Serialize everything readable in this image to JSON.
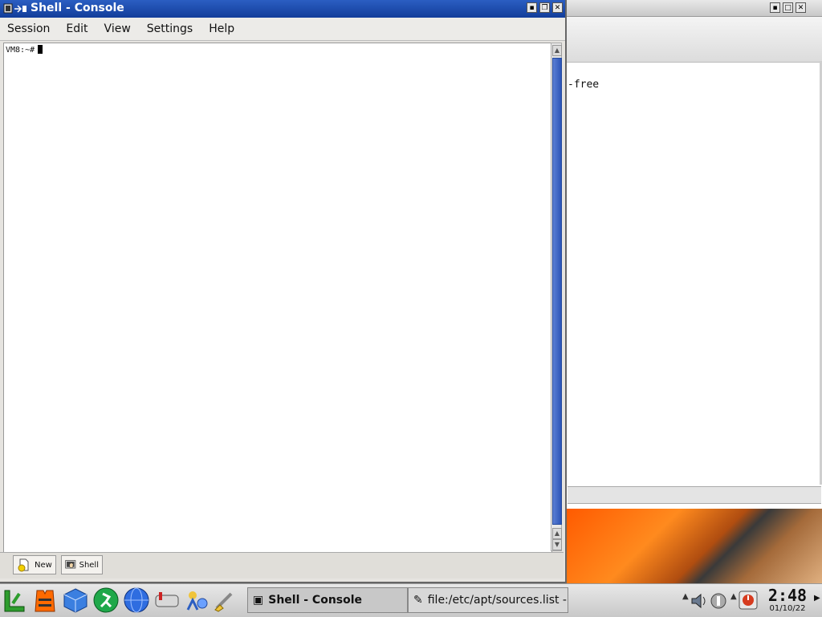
{
  "console": {
    "title": "Shell - Console",
    "menu": [
      "Session",
      "Edit",
      "View",
      "Settings",
      "Help"
    ],
    "prompt": "VM8:~#",
    "tabs": [
      {
        "label": "New",
        "icon": "new-session-icon"
      },
      {
        "label": "Shell",
        "icon": "shell-icon"
      }
    ]
  },
  "back_window": {
    "visible_text": "-free"
  },
  "taskbar": {
    "launchers": [
      "kde-menu-icon",
      "lifejacket-icon",
      "cube-icon",
      "runner-icon",
      "globe-icon",
      "mailbox-icon",
      "settings-icon",
      "brush-icon"
    ],
    "tasks": [
      {
        "label": "Shell - Console",
        "active": true
      },
      {
        "label": "file:/etc/apt/sources.list - T",
        "active": false
      }
    ],
    "clock": {
      "time": "2:48",
      "date": "01/10/22"
    }
  },
  "colors": {
    "title_active": "#1f4fb0",
    "wallpaper_accent": "#ff6a00"
  }
}
